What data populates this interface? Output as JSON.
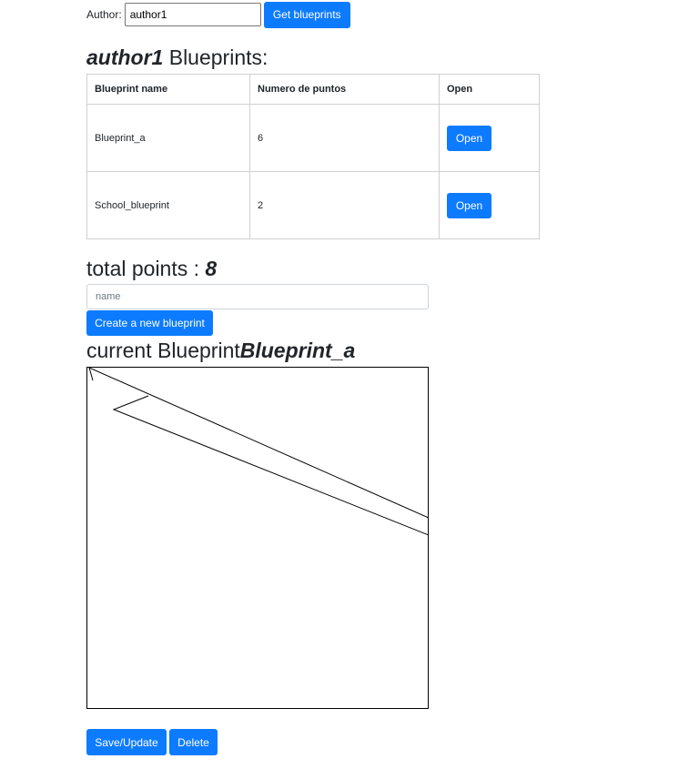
{
  "author": {
    "label": "Author:",
    "input_value": "author1",
    "get_button_label": "Get blueprints"
  },
  "blueprints_heading": {
    "author": "author1",
    "suffix": " Blueprints:"
  },
  "table": {
    "headers": [
      "Blueprint name",
      "Numero de puntos",
      "Open"
    ],
    "rows": [
      {
        "name": "Blueprint_a",
        "points": "6",
        "open_label": "Open"
      },
      {
        "name": "School_blueprint",
        "points": "2",
        "open_label": "Open"
      }
    ]
  },
  "total": {
    "label": "total points : ",
    "value": "8"
  },
  "new_blueprint": {
    "placeholder": "name",
    "create_label": "Create a new blueprint"
  },
  "current": {
    "label": "current Blueprint",
    "name": "Blueprint_a"
  },
  "actions": {
    "save_label": "Save/Update",
    "delete_label": "Delete"
  },
  "colors": {
    "primary": "#0d7bff"
  }
}
